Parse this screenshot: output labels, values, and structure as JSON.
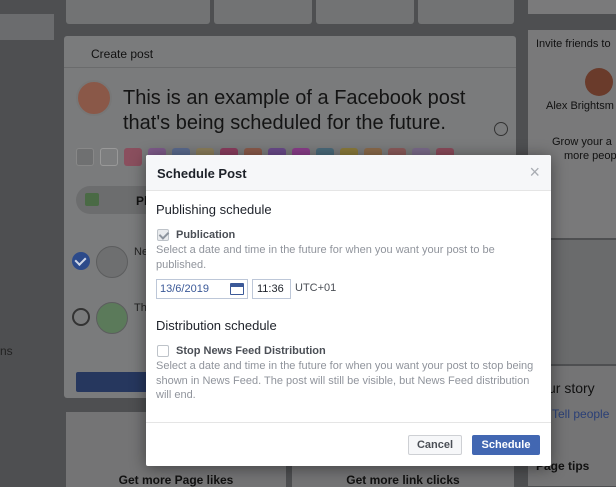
{
  "composer": {
    "title": "Create post",
    "text_line1": "This is an example of a Facebook post",
    "text_line2": "that's being scheduled for the future.",
    "photo_label": "Photo/V"
  },
  "background": {
    "left_fragment": "ns",
    "invite_text": "Invite friends to",
    "friend_name": "Alex Brightsm",
    "grow_line1": "Grow your a",
    "grow_line2": "more peop",
    "story_heading": "ur story",
    "tell_people": "Tell people",
    "page_tips": "Page tips",
    "bottom_card_1": "Get more Page likes",
    "bottom_card_2": "Get more link clicks",
    "share_row_1_label": "Ne",
    "share_row_2_label": "Th"
  },
  "modal": {
    "title": "Schedule Post",
    "close_glyph": "×",
    "publishing": {
      "heading": "Publishing schedule",
      "option_label": "Publication",
      "checked": true,
      "help": "Select a date and time in the future for when you want your post to be published.",
      "date": "13/6/2019",
      "time": "11:36",
      "timezone": "UTC+01"
    },
    "distribution": {
      "heading": "Distribution schedule",
      "option_label": "Stop News Feed Distribution",
      "checked": false,
      "help": "Select a date and time in the future for when you want your post to stop being shown in News Feed. The post will still be visible, but News Feed distribution will end."
    },
    "buttons": {
      "cancel": "Cancel",
      "schedule": "Schedule"
    }
  },
  "colors": {
    "primary_button": "#4267b2",
    "overlay": "#4e4f51"
  }
}
